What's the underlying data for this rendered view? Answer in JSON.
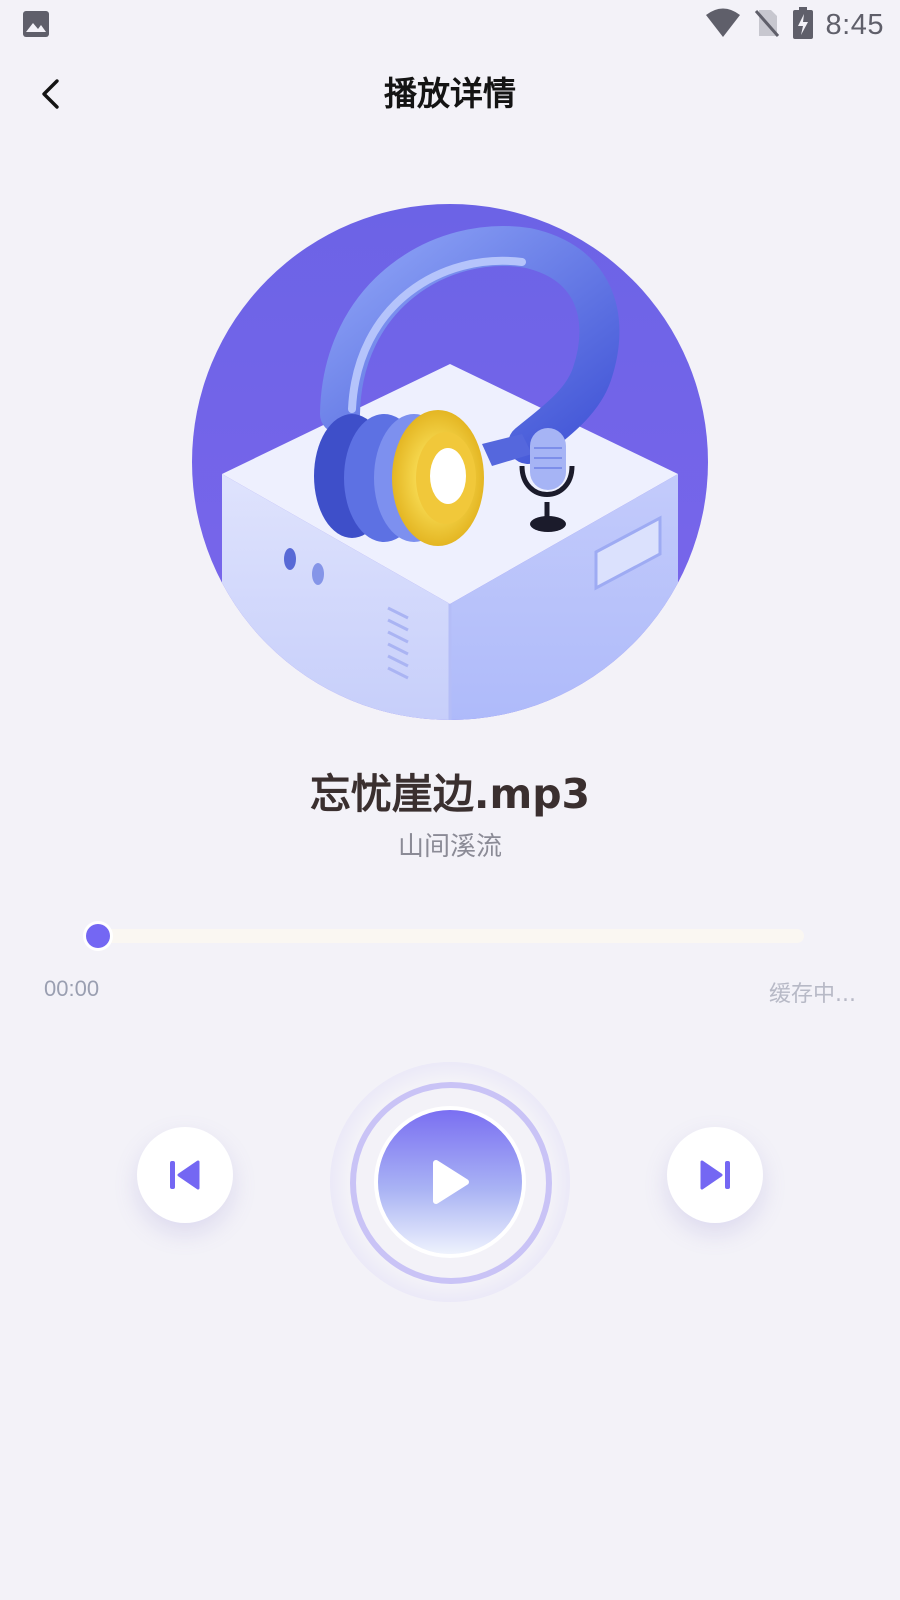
{
  "status_bar": {
    "time": "8:45",
    "icons": [
      "image-icon",
      "wifi-icon",
      "no-sim-icon",
      "battery-charging-icon"
    ]
  },
  "header": {
    "title": "播放详情",
    "back_icon": "chevron-left-icon"
  },
  "cover": {
    "illustration": "headphones-on-box-with-microphone",
    "colors": {
      "bg_top": "#6c5ce7",
      "bg_bottom": "#7c6cf0",
      "box": "#cfd6fb",
      "headphones": "#5b6fe0",
      "accent": "#f3cf3c"
    }
  },
  "track": {
    "title": "忘忧崖边.mp3",
    "artist": "山间溪流"
  },
  "progress": {
    "current_time": "00:00",
    "status": "缓存中...",
    "fraction": 0.0
  },
  "controls": {
    "prev_icon": "skip-previous-icon",
    "play_icon": "play-icon",
    "next_icon": "skip-next-icon",
    "accent": "#7467f3"
  }
}
